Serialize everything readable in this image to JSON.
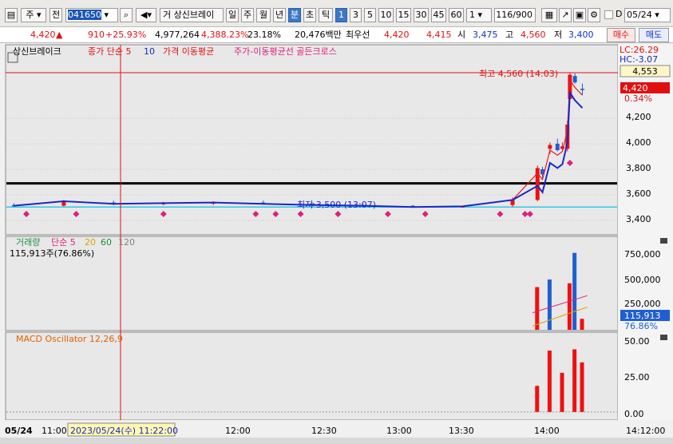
{
  "toolbar": {
    "market": "주",
    "all": "전",
    "code": "041650",
    "name": "상신브레이",
    "group_label": "거",
    "periods": [
      "일",
      "주",
      "월",
      "년",
      "분",
      "초",
      "틱"
    ],
    "selected_period": "분",
    "intervals": [
      "1",
      "3",
      "5",
      "10",
      "15",
      "30",
      "45",
      "60"
    ],
    "selected_interval": "1",
    "count": "116",
    "count_total": "/900",
    "d_label": "D",
    "date": "05/24"
  },
  "quote": {
    "price": "4,420",
    "change": "910",
    "change_pct": "+25.93%",
    "volume": "4,977,264",
    "volume_pct": "4,388.23%",
    "turnover_ratio": "23.18%",
    "amount": "20,476백만",
    "best_ask_label": "최우선",
    "best_ask": "4,420",
    "best_bid": "4,415",
    "open_label": "시",
    "open": "3,475",
    "high_label": "고",
    "high": "4,560",
    "low_label": "저",
    "low": "3,400",
    "buy": "매수",
    "sell": "매도"
  },
  "price_pane": {
    "tab": "상신브레이크",
    "legend": [
      "종가 단순 5",
      "10",
      "가격 이동평균",
      "주가-이동평균선 골든크로스"
    ],
    "lc": "LC:26.29",
    "hc": "HC:-3.07",
    "high_annotation": "최고 4,560 (14:03)",
    "low_annotation": "최저 3,500 (13:07)",
    "box_high": "4,553",
    "box_current": "4,420",
    "box_pct": "0.34%",
    "y_ticks": [
      "4,200",
      "4,000",
      "3,800",
      "3,600",
      "3,400"
    ]
  },
  "volume_pane": {
    "title": "거래량",
    "legend": [
      "단순 5",
      "20",
      "60",
      "120"
    ],
    "value": "115,913주(76.86%)",
    "y_ticks": [
      "750,000",
      "500,000",
      "250,000"
    ],
    "box_value": "115,913",
    "box_pct": "76.86%"
  },
  "macd_pane": {
    "title": "MACD Oscillator 12,26,9",
    "y_ticks": [
      "50.00",
      "25.00",
      "0.00"
    ]
  },
  "time_axis": {
    "left_date": "05/24",
    "cursor_label": "2023/05/24(수) 11:22:00",
    "ticks": [
      "11:00",
      "12:00",
      "12:30",
      "13:00",
      "13:30",
      "14:00"
    ],
    "right_label": "14:12:00"
  },
  "colors": {
    "up": "#f01010",
    "down": "#1f5fd0",
    "ma5": "#e02020",
    "ma10": "#1a28c8",
    "level": "#000000",
    "cyan": "#30c8e8",
    "signal": "#e0207a"
  },
  "chart_data": [
    {
      "type": "candlestick",
      "x_range": [
        "10:17",
        "14:12"
      ],
      "ylim": [
        3300,
        4650
      ],
      "series": [
        {
          "name": "종가 단순 5",
          "values": []
        },
        {
          "name": "10",
          "values": []
        }
      ],
      "candles": [
        {
          "t": "10:20",
          "o": 3520,
          "h": 3535,
          "l": 3505,
          "c": 3515
        },
        {
          "t": "10:40",
          "o": 3515,
          "h": 3560,
          "l": 3510,
          "c": 3550
        },
        {
          "t": "11:00",
          "o": 3540,
          "h": 3555,
          "l": 3520,
          "c": 3530
        },
        {
          "t": "11:20",
          "o": 3530,
          "h": 3545,
          "l": 3520,
          "c": 3535
        },
        {
          "t": "11:40",
          "o": 3535,
          "h": 3550,
          "l": 3520,
          "c": 3540
        },
        {
          "t": "12:00",
          "o": 3540,
          "h": 3555,
          "l": 3525,
          "c": 3530
        },
        {
          "t": "12:20",
          "o": 3530,
          "h": 3540,
          "l": 3510,
          "c": 3520
        },
        {
          "t": "12:40",
          "o": 3520,
          "h": 3530,
          "l": 3505,
          "c": 3515
        },
        {
          "t": "13:00",
          "o": 3515,
          "h": 3520,
          "l": 3500,
          "c": 3505
        },
        {
          "t": "13:20",
          "o": 3505,
          "h": 3515,
          "l": 3500,
          "c": 3510
        },
        {
          "t": "13:40",
          "o": 3520,
          "h": 3580,
          "l": 3505,
          "c": 3560
        },
        {
          "t": "13:50",
          "o": 3560,
          "h": 3830,
          "l": 3550,
          "c": 3810
        },
        {
          "t": "13:52",
          "o": 3800,
          "h": 3820,
          "l": 3720,
          "c": 3760
        },
        {
          "t": "13:55",
          "o": 3960,
          "h": 4010,
          "l": 3920,
          "c": 3990
        },
        {
          "t": "13:58",
          "o": 4000,
          "h": 4040,
          "l": 3940,
          "c": 3950
        },
        {
          "t": "14:00",
          "o": 3960,
          "h": 4010,
          "l": 3950,
          "c": 3980
        },
        {
          "t": "14:02",
          "o": 3960,
          "h": 4180,
          "l": 3940,
          "c": 4150
        },
        {
          "t": "14:03",
          "o": 4350,
          "h": 4560,
          "l": 4340,
          "c": 4540
        },
        {
          "t": "14:05",
          "o": 4530,
          "h": 4550,
          "l": 4470,
          "c": 4480
        },
        {
          "t": "14:08",
          "o": 4430,
          "h": 4470,
          "l": 4380,
          "c": 4420
        }
      ],
      "levels": [
        3690,
        3505
      ],
      "annotations": [
        {
          "text": "최고 4,560 (14:03)",
          "value": 4560
        },
        {
          "text": "최저 3,500 (13:07)",
          "value": 3500
        }
      ]
    },
    {
      "type": "bar",
      "title": "거래량",
      "ylim": [
        0,
        900000
      ],
      "values_highlight": [
        {
          "t": "13:50",
          "v": 450000
        },
        {
          "t": "13:55",
          "v": 530000
        },
        {
          "t": "14:03",
          "v": 490000
        },
        {
          "t": "14:05",
          "v": 810000
        },
        {
          "t": "14:08",
          "v": 115913
        }
      ],
      "ma5_last": 360000,
      "ma20_last": 240000
    },
    {
      "type": "bar",
      "title": "MACD Oscillator 12,26,9",
      "ylim": [
        -5,
        55
      ],
      "values_highlight": [
        {
          "t": "13:50",
          "v": 20
        },
        {
          "t": "13:55",
          "v": 47
        },
        {
          "t": "14:00",
          "v": 30
        },
        {
          "t": "14:05",
          "v": 48
        },
        {
          "t": "14:08",
          "v": 38
        }
      ]
    }
  ]
}
